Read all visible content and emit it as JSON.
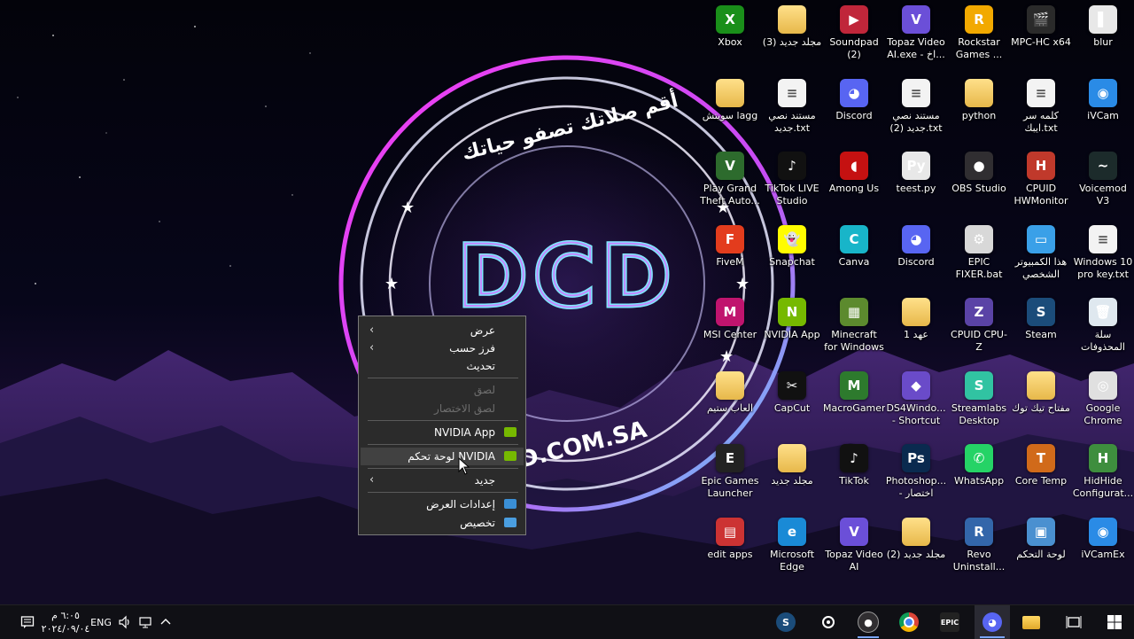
{
  "wallpaper": {
    "arabic_text": "أقم صلاتك تصفو حياتك",
    "logo_text": "DCD",
    "url_text": "D.COM.SA"
  },
  "desktop_icons": [
    {
      "label": "blur",
      "color": "#e8e8e8",
      "glyph": "▌"
    },
    {
      "label": "MPC-HC x64",
      "color": "#2a2a2a",
      "glyph": "🎬"
    },
    {
      "label": "Rockstar Games ...",
      "color": "#f2a900",
      "glyph": "R"
    },
    {
      "label": "Topaz Video AI.exe - اخ...",
      "color": "#6b4fd8",
      "glyph": "V"
    },
    {
      "label": "Soundpad (2)",
      "color": "#c0263a",
      "glyph": "▶"
    },
    {
      "label": "مجلد جديد (3)",
      "color": "folder",
      "glyph": ""
    },
    {
      "label": "Xbox",
      "color": "#1a8f1a",
      "glyph": "X"
    },
    {
      "label": "iVCam",
      "color": "#2a8be6",
      "glyph": "◉"
    },
    {
      "label": "كلمه سر ايبك.txt",
      "color": "doc",
      "glyph": "≡"
    },
    {
      "label": "python",
      "color": "folder",
      "glyph": ""
    },
    {
      "label": "مستند نصي جديد (2).txt",
      "color": "doc",
      "glyph": "≡"
    },
    {
      "label": "Discord",
      "color": "#5865f2",
      "glyph": "◕"
    },
    {
      "label": "مستند نصي جديد.txt",
      "color": "doc",
      "glyph": "≡"
    },
    {
      "label": "سويتش lagg",
      "color": "folder",
      "glyph": ""
    },
    {
      "label": "Voicemod V3",
      "color": "#1c2b2b",
      "glyph": "~"
    },
    {
      "label": "CPUID HWMonitor",
      "color": "#c0392b",
      "glyph": "H"
    },
    {
      "label": "OBS Studio",
      "color": "#302e31",
      "glyph": "●"
    },
    {
      "label": "teest.py",
      "color": "#e8e8e8",
      "glyph": "Py"
    },
    {
      "label": "Among Us",
      "color": "#c51111",
      "glyph": "◖"
    },
    {
      "label": "TikTok LIVE Studio",
      "color": "#111",
      "glyph": "♪"
    },
    {
      "label": "Play Grand Theft Auto...",
      "color": "#2d6b2d",
      "glyph": "V"
    },
    {
      "label": "Windows 10 pro key.txt",
      "color": "doc",
      "glyph": "≡"
    },
    {
      "label": "هذا الكمبيوتر الشخصي",
      "color": "#3aa0e8",
      "glyph": "▭"
    },
    {
      "label": "EPIC FIXER.bat",
      "color": "#d8d8d8",
      "glyph": "⚙"
    },
    {
      "label": "Discord",
      "color": "#5865f2",
      "glyph": "◕"
    },
    {
      "label": "Canva",
      "color": "#18b5c9",
      "glyph": "C"
    },
    {
      "label": "Snapchat",
      "color": "#fffc00",
      "glyph": "👻"
    },
    {
      "label": "FiveM",
      "color": "#e33c1d",
      "glyph": "F"
    },
    {
      "label": "سلة المحذوفات",
      "color": "#dfe8ef",
      "glyph": "🗑"
    },
    {
      "label": "Steam",
      "color": "#1b4c7a",
      "glyph": "S"
    },
    {
      "label": "CPUID CPU-Z",
      "color": "#5a43a6",
      "glyph": "Z"
    },
    {
      "label": "عهد 1",
      "color": "folder",
      "glyph": ""
    },
    {
      "label": "Minecraft for Windows",
      "color": "#5c8a2e",
      "glyph": "▦"
    },
    {
      "label": "NVIDIA App",
      "color": "#76b900",
      "glyph": "N"
    },
    {
      "label": "MSI Center",
      "color": "#c0146e",
      "glyph": "M"
    },
    {
      "label": "Google Chrome",
      "color": "#e0e0e0",
      "glyph": "◎"
    },
    {
      "label": "مفتاح تيك توك",
      "color": "folder",
      "glyph": ""
    },
    {
      "label": "Streamlabs Desktop",
      "color": "#31c3a2",
      "glyph": "S"
    },
    {
      "label": "DS4Windo... - Shortcut",
      "color": "#6a4bc9",
      "glyph": "◆"
    },
    {
      "label": "MacroGamer",
      "color": "#2d7a2d",
      "glyph": "M"
    },
    {
      "label": "CapCut",
      "color": "#111",
      "glyph": "✂"
    },
    {
      "label": "العاب ستيم",
      "color": "folder",
      "glyph": ""
    },
    {
      "label": "HidHide Configurat...",
      "color": "#3e8e3e",
      "glyph": "H"
    },
    {
      "label": "Core Temp",
      "color": "#d16a1a",
      "glyph": "T"
    },
    {
      "label": "WhatsApp",
      "color": "#25d366",
      "glyph": "✆"
    },
    {
      "label": "Photoshop... - اختصار",
      "color": "#0a2a4f",
      "glyph": "Ps"
    },
    {
      "label": "TikTok",
      "color": "#111",
      "glyph": "♪"
    },
    {
      "label": "مجلد جديد",
      "color": "folder",
      "glyph": ""
    },
    {
      "label": "Epic Games Launcher",
      "color": "#222",
      "glyph": "E"
    },
    {
      "label": "iVCamEx",
      "color": "#2a8be6",
      "glyph": "◉"
    },
    {
      "label": "لوحة التحكم",
      "color": "#4a90d0",
      "glyph": "▣"
    },
    {
      "label": "Revo Uninstall...",
      "color": "#3366aa",
      "glyph": "R"
    },
    {
      "label": "مجلد جديد (2)",
      "color": "folder",
      "glyph": ""
    },
    {
      "label": "Topaz Video AI",
      "color": "#6b4fd8",
      "glyph": "V"
    },
    {
      "label": "Microsoft Edge",
      "color": "#1a8ad6",
      "glyph": "e"
    },
    {
      "label": "edit apps",
      "color": "#c33",
      "glyph": "▤"
    }
  ],
  "context_menu": {
    "view": "عرض",
    "sort_by": "فرز حسب",
    "refresh": "تحديث",
    "paste": "لصق",
    "paste_shortcut": "لصق الاختصار",
    "nvidia_app": "NVIDIA App",
    "nvidia_cp": "لوحة تحكم NVIDIA",
    "new": "جديد",
    "display_settings": "إعدادات العرض",
    "personalize": "تخصيص"
  },
  "taskbar": {
    "time": "٦:٠٥ م",
    "date": "٢٠٢٤/٠٩/٠٤",
    "language": "ENG",
    "apps": [
      "windows-start",
      "task-view",
      "file-explorer",
      "discord",
      "epic-games",
      "chrome",
      "obs",
      "settings",
      "steam"
    ]
  }
}
